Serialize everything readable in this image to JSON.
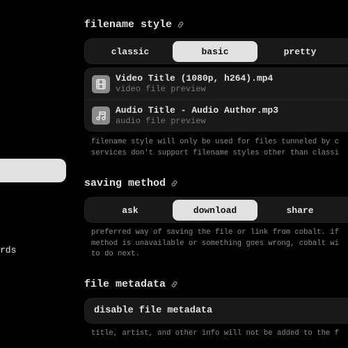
{
  "sidebar": {
    "partial_item_text": "rds"
  },
  "filename_style": {
    "title": "filename style",
    "options": [
      "classic",
      "basic",
      "pretty"
    ],
    "selected": "basic",
    "previews": [
      {
        "title": "Video Title (1080p, h264).mp4",
        "subtitle": "video file preview",
        "icon": "film-icon"
      },
      {
        "title": "Audio Title - Audio Author.mp3",
        "subtitle": "audio file preview",
        "icon": "music-note-icon"
      }
    ],
    "description": "filename style will only be used for files tunneled by c\nservices don't support filename styles other than classi"
  },
  "saving_method": {
    "title": "saving method",
    "options": [
      "ask",
      "download",
      "share"
    ],
    "selected": "download",
    "description": "preferred way of saving the file or link from cobalt. if\nmethod is unavailable or something goes wrong, cobalt wi\nto do next."
  },
  "file_metadata": {
    "title": "file metadata",
    "toggle_label": "disable file metadata",
    "description": "title, artist, and other info will not be added to the f"
  }
}
